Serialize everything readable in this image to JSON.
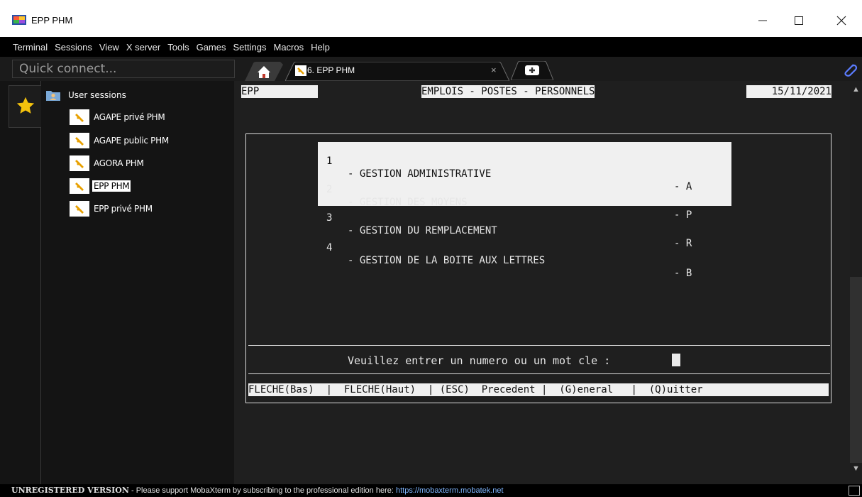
{
  "window": {
    "title": "EPP PHM",
    "min_glyph": "—",
    "max_glyph": "☐",
    "close_glyph": "✕"
  },
  "menu": [
    "Terminal",
    "Sessions",
    "View",
    "X server",
    "Tools",
    "Games",
    "Settings",
    "Macros",
    "Help"
  ],
  "quick_connect": {
    "placeholder": "Quick connect..."
  },
  "tabs": {
    "active_label": "6. EPP PHM",
    "close_glyph": "×"
  },
  "sidebar": {
    "root_label": "User sessions",
    "sessions": [
      {
        "label": "AGAPE privé PHM",
        "selected": false
      },
      {
        "label": "AGAPE public  PHM",
        "selected": false
      },
      {
        "label": "AGORA PHM",
        "selected": false
      },
      {
        "label": "EPP PHM",
        "selected": true
      },
      {
        "label": "EPP privé PHM",
        "selected": false
      }
    ]
  },
  "terminal": {
    "header_left": "EPP     ",
    "header_center": "EMPLOIS - POSTES - PERSONNELS",
    "header_date": "15/11/2021",
    "menu_items": [
      {
        "num": "1",
        "label": "- GESTION ADMINISTRATIVE",
        "key": "- A",
        "highlighted": true
      },
      {
        "num": "2",
        "label": "- GESTION DES MOYENS",
        "key": "- P",
        "highlighted": false
      },
      {
        "num": "3",
        "label": "- GESTION DU REMPLACEMENT",
        "key": "- R",
        "highlighted": false
      },
      {
        "num": "4",
        "label": "- GESTION DE LA BOITE AUX LETTRES",
        "key": "- B",
        "highlighted": false
      }
    ],
    "prompt": "Veuillez entrer un numero ou un mot cle :",
    "footer": "FLECHE(Bas)  |  FLECHE(Haut)  | (ESC)  Precedent |  (G)eneral   |  (Q)uitter "
  },
  "status": {
    "unregistered": "UNREGISTERED VERSION",
    "message": " -  Please support MobaXterm by subscribing to the professional edition here: ",
    "link": "https://mobaxterm.mobatek.net"
  },
  "icons": {
    "app": "mobaxterm-icon",
    "home": "home-icon",
    "key": "key-icon",
    "new_tab": "plus-icon",
    "attach": "paperclip-icon",
    "star": "star-icon",
    "folder": "user-folder-icon"
  },
  "colors": {
    "menubar_bg": "#000000",
    "terminal_bg": "#1f1f1f",
    "star": "#f4c20d",
    "key_icon": "#e8a000",
    "link": "#7fb6ff"
  }
}
